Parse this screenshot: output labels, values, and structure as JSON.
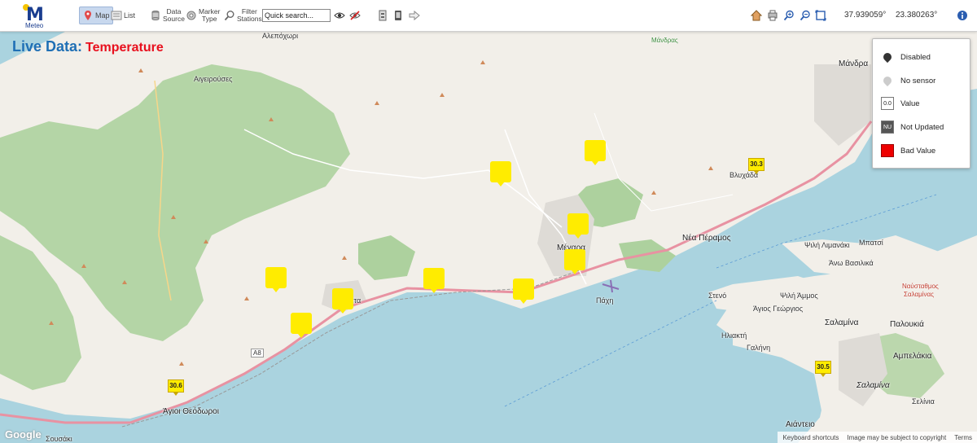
{
  "app": {
    "logo_text": "Meteo"
  },
  "toolbar": {
    "map_label": "Map",
    "list_label": "List",
    "data_source": [
      "Data",
      "Source"
    ],
    "marker_type": [
      "Marker",
      "Type"
    ],
    "filter_stations": [
      "Filter",
      "Stations"
    ],
    "search_placeholder": "Quick search...",
    "latitude": "37.939059°",
    "longitude": "23.380263°"
  },
  "title": {
    "prefix": "Live Data:",
    "parameter": "Temperature"
  },
  "legend": [
    {
      "label": "Disabled"
    },
    {
      "label": "No sensor"
    },
    {
      "label": "Value",
      "symbol_text": "0.0"
    },
    {
      "label": "Not Updated",
      "symbol_text": "NU"
    },
    {
      "label": "Bad Value"
    }
  ],
  "value_markers": [
    "30.3",
    "30.6",
    "30.5"
  ],
  "places": {
    "alepochori": "Αλεπόχωρι",
    "aigeirouses": "Αιγειρούσες",
    "mandra_small": "Μάνδρας",
    "mandra": "Μάνδρα",
    "vlychada": "Βλυχάδα",
    "nea_peramos": "Νέα Πέραμος",
    "megara": "Μέγαρα",
    "kineta": "Κινέτα",
    "pachi": "Πάχη",
    "agioi_theodoroi": "Άγιοι Θεόδωροι",
    "soussaki": "Σουσάκι",
    "salamina": "Σαλαμίνα",
    "salamina_it": "Σαλαμίνα",
    "paloukia": "Παλουκιά",
    "ampelakia": "Αμπελάκια",
    "aianteio": "Αιάντειο",
    "selinia": "Σελίνια",
    "agios_georgios": "Άγιος Γεώργιος",
    "steno": "Στενό",
    "psili_ammos": "Ψιλή Άμμος",
    "iliakti": "Ηλιακτή",
    "galini": "Γαλήνη",
    "ano_vasilika": "Άνω Βασιλικά",
    "mpatsi": "Μπατσί",
    "psili_limaniaki": "Ψιλή Λιμανάκι",
    "naval_base": [
      "Ναύσταθμος",
      "Σαλαμίνας"
    ],
    "a8": "A8"
  },
  "footer": {
    "shortcuts": "Keyboard shortcuts",
    "copyright": "Image may be subject to copyright",
    "terms": "Terms",
    "google": "Google"
  },
  "colors": {
    "title_blue": "#1f6fb5",
    "parameter_red": "#e8101e",
    "marker_yellow": "#ffec00",
    "sea": "#aad3df",
    "land": "#f2efe9",
    "forest": "#add19e",
    "highway": "#e892a2"
  }
}
